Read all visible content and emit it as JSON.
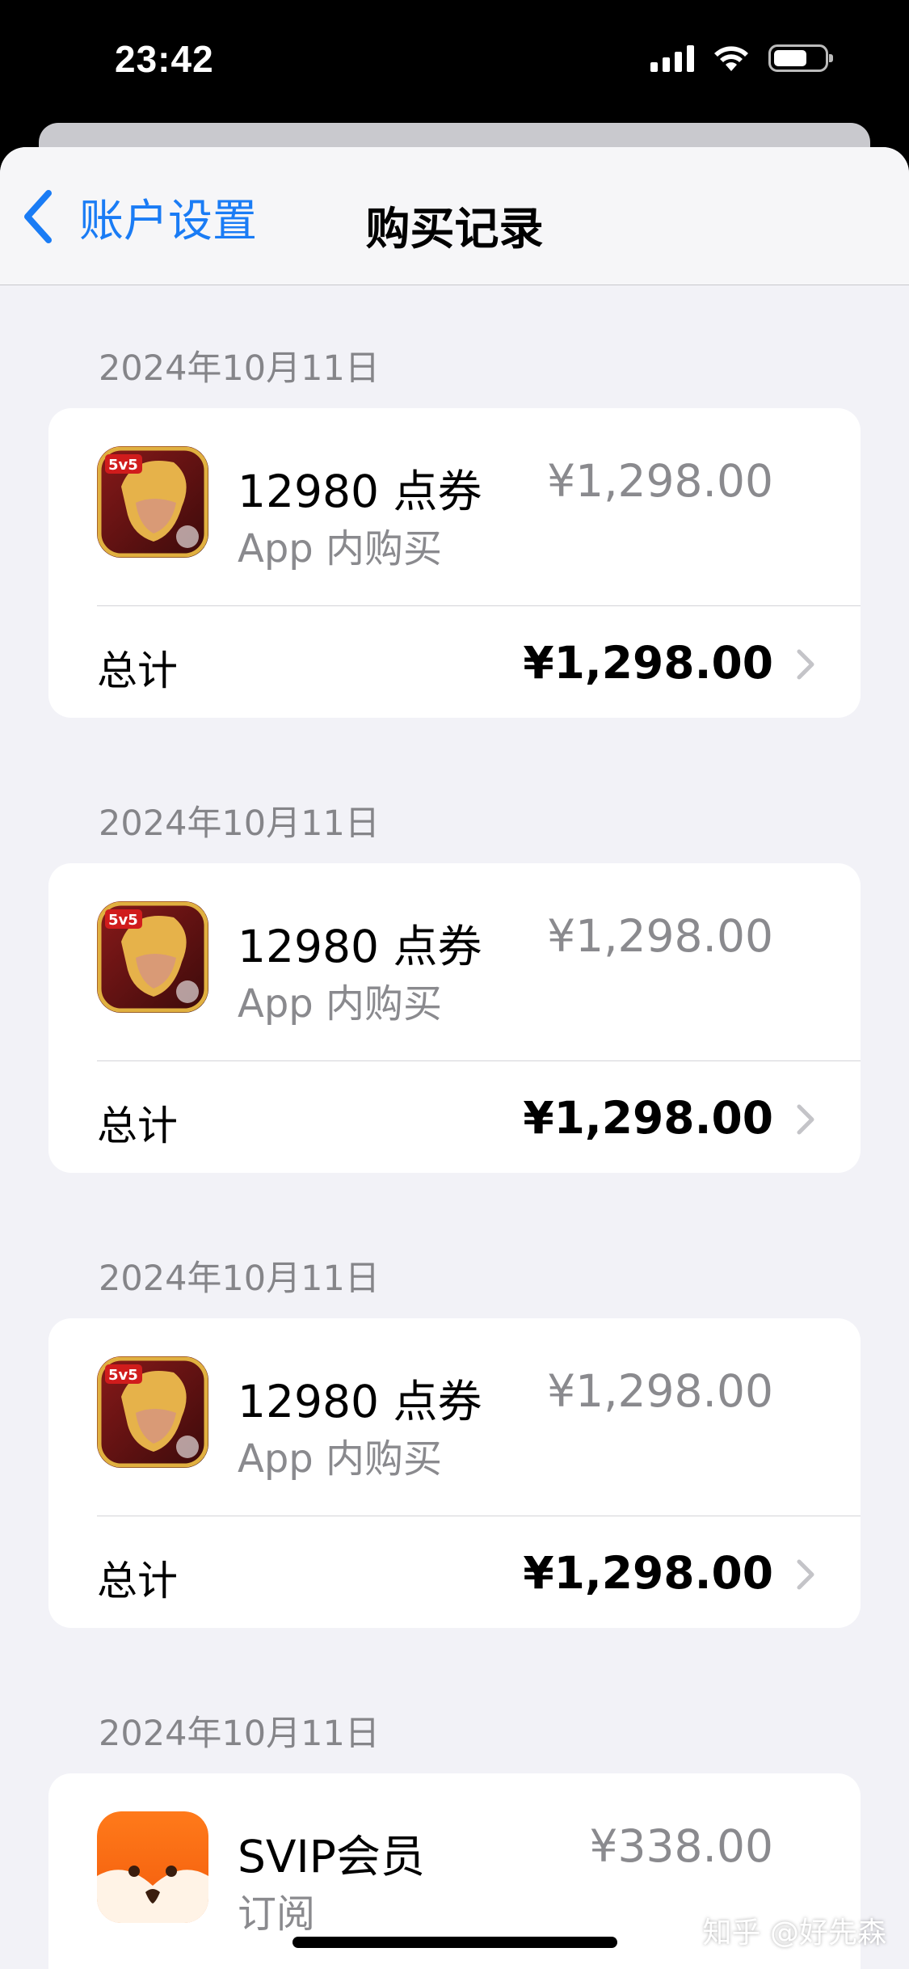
{
  "status_bar": {
    "time": "23:42",
    "icons": [
      "cellular-signal-icon",
      "wifi-icon",
      "battery-icon"
    ]
  },
  "nav": {
    "back_label": "账户设置",
    "title": "购买记录"
  },
  "purchases": [
    {
      "date": "2024年10月11日",
      "icon": "honor-of-kings-app-icon",
      "name": "12980 点券",
      "type": "App 内购买",
      "price": "¥1,298.00",
      "total_label": "总计",
      "total": "¥1,298.00"
    },
    {
      "date": "2024年10月11日",
      "icon": "honor-of-kings-app-icon",
      "name": "12980 点券",
      "type": "App 内购买",
      "price": "¥1,298.00",
      "total_label": "总计",
      "total": "¥1,298.00"
    },
    {
      "date": "2024年10月11日",
      "icon": "honor-of-kings-app-icon",
      "name": "12980 点券",
      "type": "App 内购买",
      "price": "¥1,298.00",
      "total_label": "总计",
      "total": "¥1,298.00"
    },
    {
      "date": "2024年10月11日",
      "icon": "fox-app-icon",
      "name": "SVIP会员",
      "type": "订阅",
      "price": "¥338.00"
    }
  ],
  "watermark": "知乎 @好先森",
  "colors": {
    "accent": "#1a7cf5",
    "background": "#f2f2f7",
    "secondary_text": "#8a8a8e"
  }
}
